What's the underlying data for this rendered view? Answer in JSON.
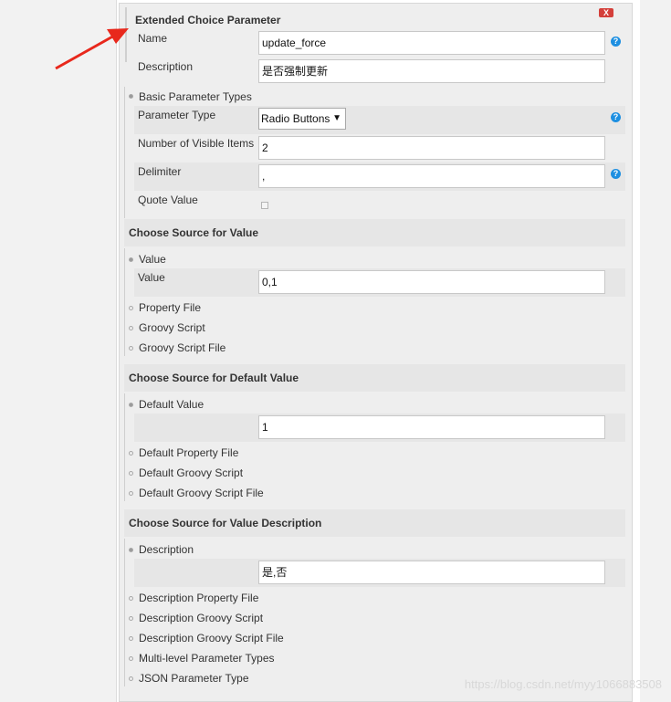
{
  "panel": {
    "title": "Extended Choice Parameter",
    "delete_label": "X",
    "name_label": "Name",
    "name_value": "update_force",
    "description_label": "Description",
    "description_value": "是否强制更新"
  },
  "basic": {
    "label": "Basic Parameter Types",
    "parameter_type_label": "Parameter Type",
    "parameter_type_value": "Radio Buttons",
    "visible_items_label": "Number of Visible Items",
    "visible_items_value": "2",
    "delimiter_label": "Delimiter",
    "delimiter_value": ",",
    "quote_value_label": "Quote Value"
  },
  "source_value": {
    "heading": "Choose Source for Value",
    "value_option": "Value",
    "value_label": "Value",
    "value_value": "0,1",
    "property_file": "Property File",
    "groovy_script": "Groovy Script",
    "groovy_script_file": "Groovy Script File"
  },
  "source_default": {
    "heading": "Choose Source for Default Value",
    "default_value_option": "Default Value",
    "default_value_value": "1",
    "default_property_file": "Default Property File",
    "default_groovy_script": "Default Groovy Script",
    "default_groovy_script_file": "Default Groovy Script File"
  },
  "source_description": {
    "heading": "Choose Source for Value Description",
    "description_option": "Description",
    "description_value": "是,否",
    "description_property_file": "Description Property File",
    "description_groovy_script": "Description Groovy Script",
    "description_groovy_script_file": "Description Groovy Script File",
    "multi_level": "Multi-level Parameter Types",
    "json_parameter": "JSON Parameter Type"
  },
  "watermark": "https://blog.csdn.net/myy1066883508",
  "colors": {
    "help": "#1d8fe1",
    "delete": "#d43f3a",
    "arrow": "#e8281c"
  }
}
